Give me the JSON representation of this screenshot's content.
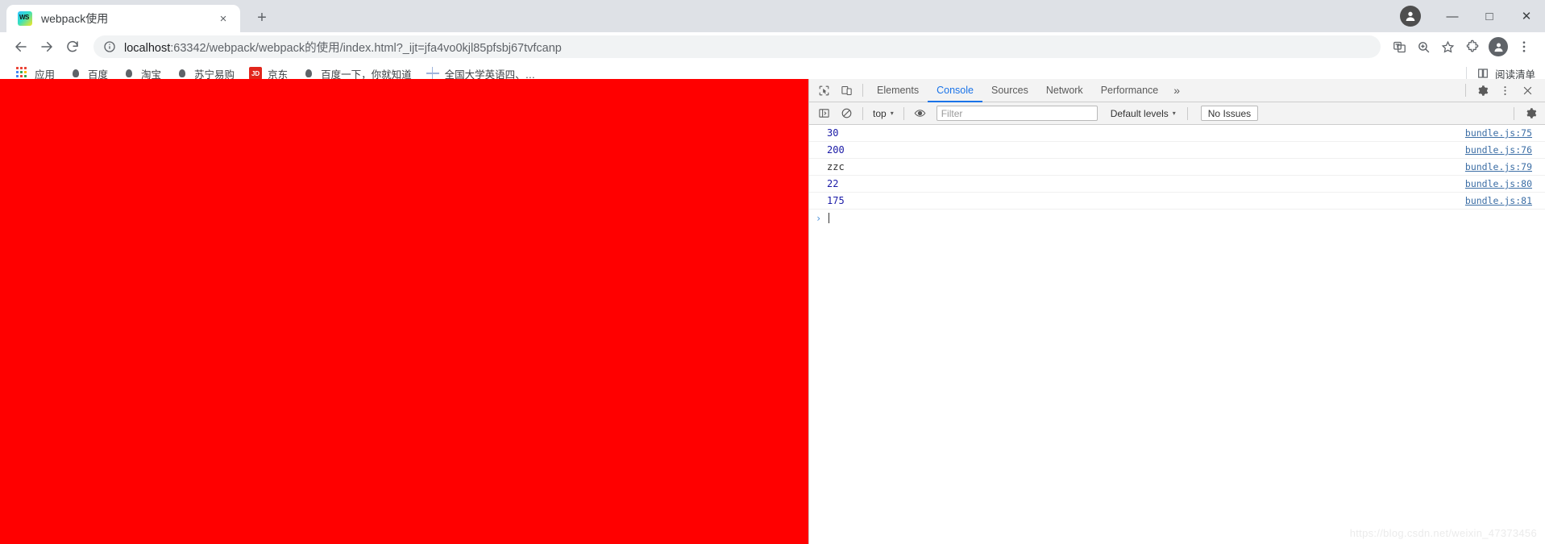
{
  "browser": {
    "tab": {
      "title": "webpack使用",
      "favicon": "webstorm-icon",
      "close": "×"
    },
    "new_tab_label": "+",
    "window_controls": {
      "minimize": "—",
      "maximize": "□",
      "close": "✕"
    },
    "nav": {
      "back": "back-arrow",
      "forward": "forward-arrow",
      "reload": "reload-icon"
    },
    "omnibox": {
      "info_icon": "info-circle-icon",
      "url_host": "localhost",
      "url_rest": ":63342/webpack/webpack的使用/index.html?_ijt=jfa4vo0kjl85pfsbj67tvfcanp",
      "translate_icon": "translate-icon",
      "zoom_icon": "zoom-icon",
      "bookmark_icon": "star-icon"
    },
    "toolbar_right": {
      "extensions": "puzzle-icon",
      "profile": "profile-avatar-icon",
      "menu": "kebab-menu-icon"
    },
    "bookmarks": [
      {
        "label": "应用",
        "icon": "apps-grid-icon"
      },
      {
        "label": "百度",
        "icon": "baidu-icon"
      },
      {
        "label": "淘宝",
        "icon": "baidu-icon"
      },
      {
        "label": "苏宁易购",
        "icon": "baidu-icon"
      },
      {
        "label": "京东",
        "icon": "jd-icon"
      },
      {
        "label": "百度一下，你就知道",
        "icon": "baidu-icon"
      },
      {
        "label": "全国大学英语四、…",
        "icon": "globe-icon"
      }
    ],
    "reading_list": {
      "label": "阅读清单",
      "icon": "reading-list-icon"
    }
  },
  "page": {
    "background_color": "#ff0000"
  },
  "devtools": {
    "inspect_icon": "inspect-cursor-icon",
    "device_icon": "device-toolbar-icon",
    "tabs": [
      {
        "label": "Elements",
        "active": false
      },
      {
        "label": "Console",
        "active": true
      },
      {
        "label": "Sources",
        "active": false
      },
      {
        "label": "Network",
        "active": false
      },
      {
        "label": "Performance",
        "active": false
      }
    ],
    "more_tabs": "»",
    "settings_icon": "gear-icon",
    "menu_icon": "kebab-menu-icon",
    "close_icon": "close-icon",
    "console_toolbar": {
      "sidebar_icon": "console-sidebar-icon",
      "clear_icon": "clear-console-icon",
      "context": "top",
      "context_caret": "▾",
      "eye_icon": "live-expression-eye-icon",
      "filter_placeholder": "Filter",
      "filter_value": "",
      "levels_label": "Default levels",
      "levels_caret": "▾",
      "issues_label": "No Issues",
      "settings_icon": "gear-icon"
    },
    "console_logs": [
      {
        "message": "30",
        "type": "number",
        "source": "bundle.js:75"
      },
      {
        "message": "200",
        "type": "number",
        "source": "bundle.js:76"
      },
      {
        "message": "zzc",
        "type": "string",
        "source": "bundle.js:79"
      },
      {
        "message": "22",
        "type": "number",
        "source": "bundle.js:80"
      },
      {
        "message": "175",
        "type": "number",
        "source": "bundle.js:81"
      }
    ],
    "prompt": {
      "caret": "›",
      "value": ""
    }
  },
  "watermark": "https://blog.csdn.net/weixin_47373456",
  "colors": {
    "accent": "#1a73e8",
    "page_red": "#ff0000",
    "tabstrip": "#dee1e6"
  }
}
